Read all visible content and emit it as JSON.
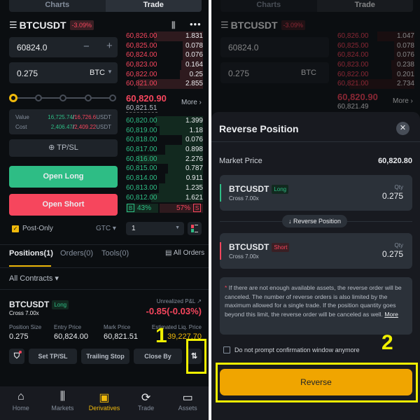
{
  "top_tabs": [
    "Charts",
    "Trade"
  ],
  "symbol": "BTCUSDT",
  "change": "-3.09%",
  "order_form": {
    "price": "60824.0",
    "qty": "0.275",
    "unit": "BTC",
    "value_label": "Value",
    "value_a": "16,725.74",
    "value_b": "16,726.6",
    "cost_label": "Cost",
    "cost_a": "2,406.47",
    "cost_b": "2,409.22",
    "currency": "USDT",
    "tpsl": "TP/SL",
    "open_long": "Open Long",
    "open_short": "Open Short",
    "post_only": "Post-Only",
    "tif": "GTC",
    "depth": "1"
  },
  "orderbook_left": {
    "asks": [
      [
        "60,826.00",
        "1.831"
      ],
      [
        "60,825.00",
        "0.078"
      ],
      [
        "60,824.00",
        "0.076"
      ],
      [
        "60,823.00",
        "0.164"
      ],
      [
        "60,822.00",
        "0.25"
      ],
      [
        "60,821.00",
        "2.855"
      ]
    ],
    "last": "60,820.90",
    "mark": "60,821.51",
    "more": "More ›",
    "bids": [
      [
        "60,820.00",
        "1.399"
      ],
      [
        "60,819.00",
        "1.18"
      ],
      [
        "60,818.00",
        "0.076"
      ],
      [
        "60,817.00",
        "0.898"
      ],
      [
        "60,816.00",
        "2.276"
      ],
      [
        "60,815.00",
        "0.787"
      ],
      [
        "60,814.00",
        "0.911"
      ],
      [
        "60,813.00",
        "1.235"
      ],
      [
        "60,812.00",
        "1.621"
      ]
    ],
    "buy_pct": "43%",
    "sell_pct": "57%",
    "b": "B",
    "s": "S"
  },
  "orderbook_right": {
    "asks": [
      [
        "60,826.00",
        "1.047"
      ],
      [
        "60,825.00",
        "0.078"
      ],
      [
        "60,824.00",
        "0.076"
      ],
      [
        "60,823.00",
        "0.238"
      ],
      [
        "60,822.00",
        "0.201"
      ],
      [
        "60,821.00",
        "2.734"
      ]
    ],
    "last": "60,820.90",
    "mark": "60,821.49"
  },
  "positions": {
    "tabs": [
      "Positions(1)",
      "Orders(0)",
      "Tools(0)"
    ],
    "all_orders": "All Orders",
    "filter": "All Contracts",
    "symbol": "BTCUSDT",
    "side": "Long",
    "margin": "Cross 7.00x",
    "pnl_label": "Unrealized P&L",
    "pnl": "-0.85(-0.03%)",
    "size_label": "Position Size",
    "size": "0.275",
    "entry_label": "Entry Price",
    "entry": "60,824.00",
    "mark_label": "Mark Price",
    "mark": "60,821.51",
    "liq_label": "Estimated Liq. Price",
    "liq": "39,227.70",
    "buttons": [
      "Set TP/SL",
      "Trailing Stop",
      "Close By"
    ]
  },
  "nav": [
    "Home",
    "Markets",
    "Derivatives",
    "Trade",
    "Assets"
  ],
  "dialog": {
    "title": "Reverse Position",
    "market_label": "Market Price",
    "market_price": "60,820.80",
    "from": {
      "symbol": "BTCUSDT",
      "side": "Long",
      "margin": "Cross 7.00x",
      "qty_label": "Qty",
      "qty": "0.275"
    },
    "divider": "↓ Reverse Position",
    "to": {
      "symbol": "BTCUSDT",
      "side": "Short",
      "margin": "Cross 7.00x",
      "qty_label": "Qty",
      "qty": "0.275"
    },
    "note": "If there are not enough available assets, the reverse order will be canceled. The number of reverse orders is also limited by the maximum allowed for a single trade. If the position quantity goes beyond this limit, the reverse order will be canceled as well.",
    "more": "More",
    "checkbox": "Do not prompt confirmation window anymore",
    "confirm": "Reverse"
  },
  "annotations": [
    "1",
    "2"
  ],
  "colors": {
    "accent": "#f0b90b",
    "green": "#2ebd85",
    "red": "#f6465d",
    "highlight": "#f0f000"
  }
}
